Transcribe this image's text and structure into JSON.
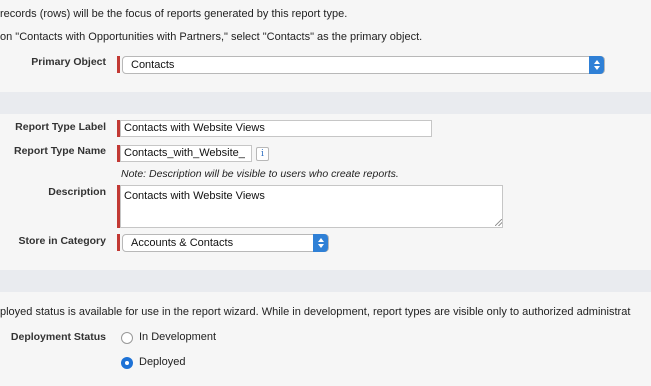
{
  "intro": {
    "line1": "records (rows) will be the focus of reports generated by this report type.",
    "line2": "on \"Contacts with Opportunities with Partners,\" select \"Contacts\" as the primary object."
  },
  "primary_object": {
    "label": "Primary Object",
    "value": "Contacts"
  },
  "report_type_label": {
    "label": "Report Type Label",
    "value": "Contacts with Website Views"
  },
  "report_type_name": {
    "label": "Report Type Name",
    "value": "Contacts_with_Website_",
    "info_icon": "i"
  },
  "note": "Note: Description will be visible to users who create reports.",
  "description": {
    "label": "Description",
    "value": "Contacts with Website Views"
  },
  "category": {
    "label": "Store in Category",
    "value": "Accounts & Contacts"
  },
  "deployment_intro": "ployed status is available for use in the report wizard. While in development, report types are visible only to authorized administrat",
  "deployment": {
    "label": "Deployment Status",
    "options": [
      {
        "label": "In Development",
        "selected": false
      },
      {
        "label": "Deployed",
        "selected": true
      }
    ]
  },
  "colors": {
    "required_bar": "#c23934",
    "select_accent": "#2f80d6",
    "radio_selected": "#1d72d6",
    "section_band": "#e9ebef"
  }
}
